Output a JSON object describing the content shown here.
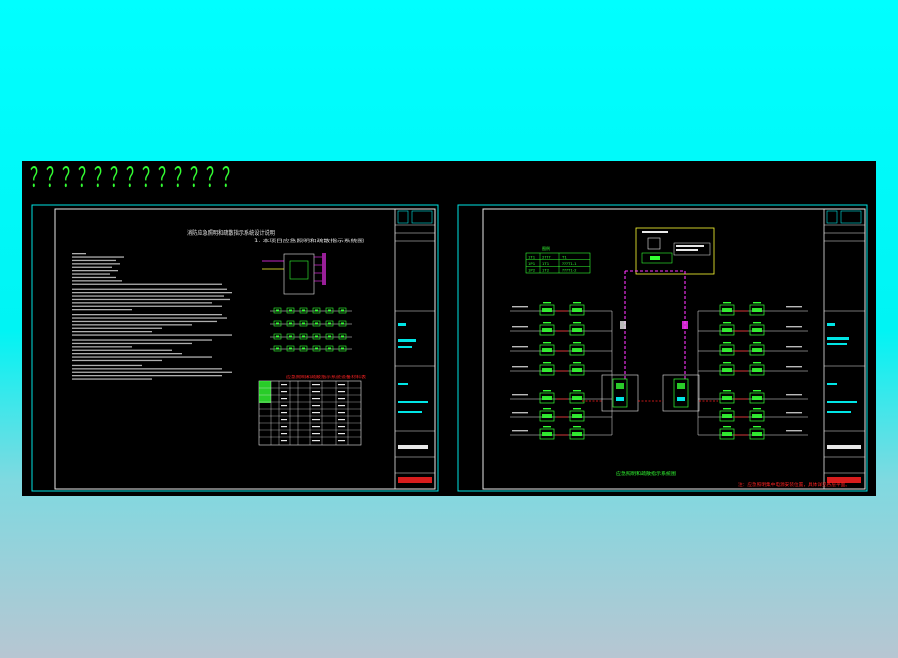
{
  "header_marks": "？？？？？？？？？？？？？",
  "sheet1": {
    "title": "消防应急照明和疏散指示系统设计说明",
    "right_block_title": "1. 本项目应急照明和疏散指示系统图",
    "table_caption": "应急照明和疏散指示系统设备材料表"
  },
  "sheet2": {
    "legend_title": "图例",
    "legend_rows": [
      [
        "1T1",
        "2??? ",
        "T1"
      ],
      [
        "1P1",
        "1T1",
        "???T1-1"
      ],
      [
        "1P2",
        "1T2",
        "???T1-2"
      ]
    ],
    "diagram_title": "应急照明和疏散指示系统图",
    "note_red": "注：应急照明集中电源安装位置，具体详见各层平面。"
  },
  "colors": {
    "frame": "#00e5e5",
    "green": "#33ff33",
    "magenta": "#ff33ff",
    "yellow": "#ffff33",
    "white": "#e8e8e8",
    "red": "#ff2222"
  }
}
